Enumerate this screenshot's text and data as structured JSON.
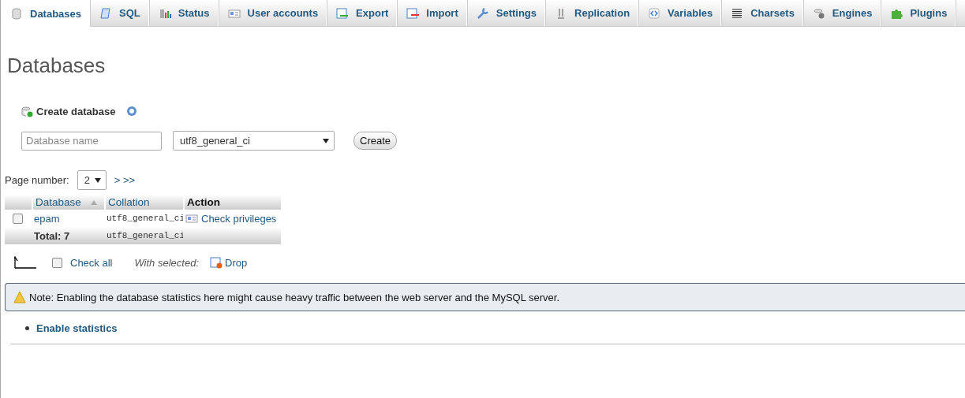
{
  "tabs": [
    {
      "label": "Databases",
      "selected": true
    },
    {
      "label": "SQL",
      "selected": false
    },
    {
      "label": "Status",
      "selected": false
    },
    {
      "label": "User accounts",
      "selected": false
    },
    {
      "label": "Export",
      "selected": false
    },
    {
      "label": "Import",
      "selected": false
    },
    {
      "label": "Settings",
      "selected": false
    },
    {
      "label": "Replication",
      "selected": false
    },
    {
      "label": "Variables",
      "selected": false
    },
    {
      "label": "Charsets",
      "selected": false
    },
    {
      "label": "Engines",
      "selected": false
    },
    {
      "label": "Plugins",
      "selected": false
    }
  ],
  "page_title": "Databases",
  "create_database": {
    "heading": "Create database",
    "name_field": {
      "placeholder": "Database name"
    },
    "collation_select": {
      "value": "utf8_general_ci"
    },
    "create_button": "Create"
  },
  "pagination": {
    "label": "Page number:",
    "page_select": {
      "value": "2"
    },
    "next_links": "> >>"
  },
  "table": {
    "columns": [
      {
        "label": "Database",
        "sorted": true
      },
      {
        "label": "Collation",
        "sorted": false
      },
      {
        "label": "Action",
        "sorted": false
      }
    ],
    "rows": [
      {
        "checked": false,
        "database": "epam",
        "collation": "utf8_general_ci",
        "action": "Check privileges"
      }
    ],
    "footer": {
      "total": "Total: 7",
      "collation": "utf8_general_ci"
    }
  },
  "bulk_actions": {
    "check_all": {
      "label": "Check all",
      "checked": false
    },
    "with_selected": "With selected:",
    "drop": "Drop"
  },
  "note": "Note: Enabling the database statistics here might cause heavy traffic between the web server and the MySQL server.",
  "links": [
    "Enable statistics"
  ]
}
